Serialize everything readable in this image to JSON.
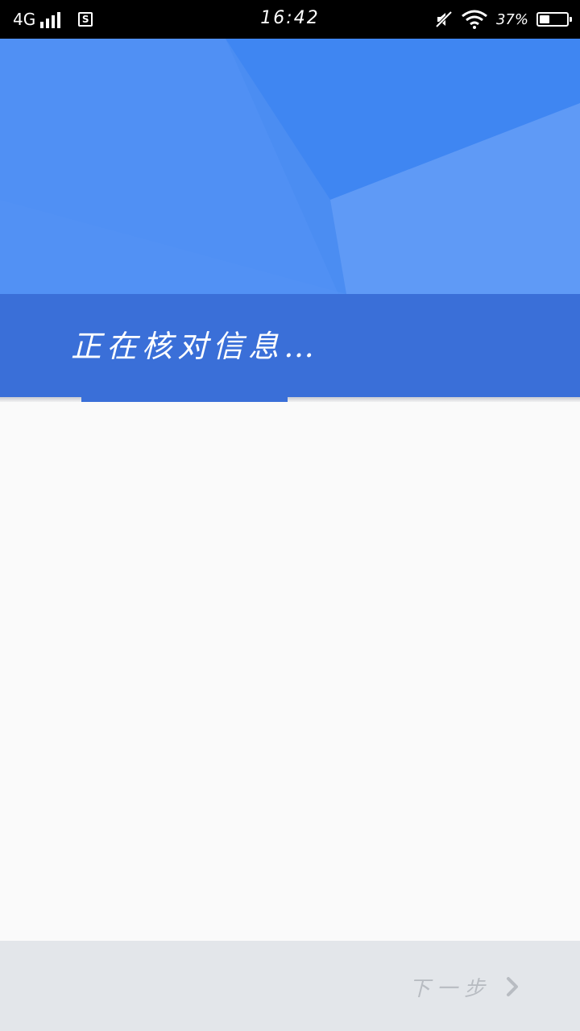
{
  "status_bar": {
    "network": "4G",
    "sim_label": "S",
    "time": "16:42",
    "battery_percent": "37%",
    "battery_level": 0.37,
    "icons": [
      "signal-icon",
      "sim-icon",
      "mute-icon",
      "wifi-icon",
      "battery-charging-icon"
    ]
  },
  "header": {
    "status_text": "正在核对信息…",
    "step_progress": 0.36
  },
  "footer": {
    "next_label": "下一步",
    "next_icon": "chevron-right-icon"
  },
  "colors": {
    "hero_blue": "#4b8df2",
    "band_blue": "#3a6fd8",
    "footer_bg": "#e3e6ea",
    "disabled_text": "#b8bcc2"
  }
}
